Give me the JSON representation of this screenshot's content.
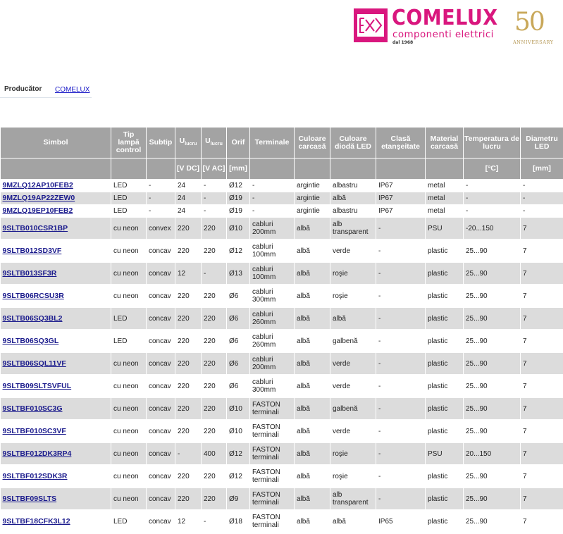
{
  "logo": {
    "brand": "COMELUX",
    "tagline": "componenti elettrici",
    "since": "dal 1968",
    "anniversary_number": "50",
    "anniversary_text": "ANNIVERSARY",
    "brand_color": "#d9177e",
    "gold_color": "#c9a85a"
  },
  "producer": {
    "label": "Producător",
    "value": "COMELUX"
  },
  "table": {
    "headers": {
      "simbol": "Simbol",
      "tip": "Tip lampă control",
      "subtip": "Subtip",
      "ulucru_dc_main": "U",
      "ulucru_dc_sub": "lucru",
      "ulucru_ac_main": "U",
      "ulucru_ac_sub": "lucru",
      "orif": "Orif",
      "terminale": "Terminale",
      "culoare_carcasa": "Culoare carcasă",
      "culoare_dioda": "Culoare diodă LED",
      "clasa": "Clasă etanşeitate",
      "material": "Material carcasă",
      "temperatura": "Temperatura de lucru",
      "diametru": "Diametru LED"
    },
    "units": {
      "dc": "[V DC]",
      "ac": "[V AC]",
      "orif": "[mm]",
      "temperatura": "[°C]",
      "diametru": "[mm]"
    },
    "rows": [
      {
        "simbol": "9MZLQ12AP10FEB2",
        "tip": "LED",
        "subtip": "-",
        "vdc": "24",
        "vac": "-",
        "orif": "Ø12",
        "terminale": "-",
        "carcasa": "argintie",
        "dioda": "albastru",
        "clasa": "IP67",
        "material": "metal",
        "temp": "-",
        "diam": "-"
      },
      {
        "simbol": "9MZLQ19AP22ZEW0",
        "tip": "LED",
        "subtip": "-",
        "vdc": "24",
        "vac": "-",
        "orif": "Ø19",
        "terminale": "-",
        "carcasa": "argintie",
        "dioda": "albă",
        "clasa": "IP67",
        "material": "metal",
        "temp": "-",
        "diam": "-"
      },
      {
        "simbol": "9MZLQ19EP10FEB2",
        "tip": "LED",
        "subtip": "-",
        "vdc": "24",
        "vac": "-",
        "orif": "Ø19",
        "terminale": "-",
        "carcasa": "argintie",
        "dioda": "albastru",
        "clasa": "IP67",
        "material": "metal",
        "temp": "-",
        "diam": "-"
      },
      {
        "simbol": "9SLTB010CSR1BP",
        "tip": "cu neon",
        "subtip": "convex",
        "vdc": "220",
        "vac": "220",
        "orif": "Ø10",
        "terminale": "cabluri 200mm",
        "carcasa": "albă",
        "dioda": "alb transparent",
        "clasa": "-",
        "material": "PSU",
        "temp": "-20...150",
        "diam": "7"
      },
      {
        "simbol": "9SLTB012SD3VF",
        "tip": "cu neon",
        "subtip": "concav",
        "vdc": "220",
        "vac": "220",
        "orif": "Ø12",
        "terminale": "cabluri 100mm",
        "carcasa": "albă",
        "dioda": "verde",
        "clasa": "-",
        "material": "plastic",
        "temp": "25...90",
        "diam": "7"
      },
      {
        "simbol": "9SLTB013SF3R",
        "tip": "cu neon",
        "subtip": "concav",
        "vdc": "12",
        "vac": "-",
        "orif": "Ø13",
        "terminale": "cabluri 100mm",
        "carcasa": "albă",
        "dioda": "roşie",
        "clasa": "-",
        "material": "plastic",
        "temp": "25...90",
        "diam": "7"
      },
      {
        "simbol": "9SLTB06RCSU3R",
        "tip": "cu neon",
        "subtip": "concav",
        "vdc": "220",
        "vac": "220",
        "orif": "Ø6",
        "terminale": "cabluri 300mm",
        "carcasa": "albă",
        "dioda": "roşie",
        "clasa": "-",
        "material": "plastic",
        "temp": "25...90",
        "diam": "7"
      },
      {
        "simbol": "9SLTB06SQ3BL2",
        "tip": "LED",
        "subtip": "concav",
        "vdc": "220",
        "vac": "220",
        "orif": "Ø6",
        "terminale": "cabluri 260mm",
        "carcasa": "albă",
        "dioda": "albă",
        "clasa": "-",
        "material": "plastic",
        "temp": "25...90",
        "diam": "7"
      },
      {
        "simbol": "9SLTB06SQ3GL",
        "tip": "LED",
        "subtip": "concav",
        "vdc": "220",
        "vac": "220",
        "orif": "Ø6",
        "terminale": "cabluri 260mm",
        "carcasa": "albă",
        "dioda": "galbenă",
        "clasa": "-",
        "material": "plastic",
        "temp": "25...90",
        "diam": "7"
      },
      {
        "simbol": "9SLTB06SQL11VF",
        "tip": "cu neon",
        "subtip": "concav",
        "vdc": "220",
        "vac": "220",
        "orif": "Ø6",
        "terminale": "cabluri 200mm",
        "carcasa": "albă",
        "dioda": "verde",
        "clasa": "-",
        "material": "plastic",
        "temp": "25...90",
        "diam": "7"
      },
      {
        "simbol": "9SLTB09SLTSVFUL",
        "tip": "cu neon",
        "subtip": "concav",
        "vdc": "220",
        "vac": "220",
        "orif": "Ø6",
        "terminale": "cabluri 300mm",
        "carcasa": "albă",
        "dioda": "verde",
        "clasa": "-",
        "material": "plastic",
        "temp": "25...90",
        "diam": "7"
      },
      {
        "simbol": "9SLTBF010SC3G",
        "tip": "cu neon",
        "subtip": "concav",
        "vdc": "220",
        "vac": "220",
        "orif": "Ø10",
        "terminale": "FASTON terminali",
        "carcasa": "albă",
        "dioda": "galbenă",
        "clasa": "-",
        "material": "plastic",
        "temp": "25...90",
        "diam": "7"
      },
      {
        "simbol": "9SLTBF010SC3VF",
        "tip": "cu neon",
        "subtip": "concav",
        "vdc": "220",
        "vac": "220",
        "orif": "Ø10",
        "terminale": "FASTON terminali",
        "carcasa": "albă",
        "dioda": "verde",
        "clasa": "-",
        "material": "plastic",
        "temp": "25...90",
        "diam": "7"
      },
      {
        "simbol": "9SLTBF012DK3RP4",
        "tip": "cu neon",
        "subtip": "concav",
        "vdc": "-",
        "vac": "400",
        "orif": "Ø12",
        "terminale": "FASTON terminali",
        "carcasa": "albă",
        "dioda": "roşie",
        "clasa": "-",
        "material": "PSU",
        "temp": "20...150",
        "diam": "7"
      },
      {
        "simbol": "9SLTBF012SDK3R",
        "tip": "cu neon",
        "subtip": "concav",
        "vdc": "220",
        "vac": "220",
        "orif": "Ø12",
        "terminale": "FASTON terminali",
        "carcasa": "albă",
        "dioda": "roşie",
        "clasa": "-",
        "material": "plastic",
        "temp": "25...90",
        "diam": "7"
      },
      {
        "simbol": "9SLTBF09SLTS",
        "tip": "cu neon",
        "subtip": "concav",
        "vdc": "220",
        "vac": "220",
        "orif": "Ø9",
        "terminale": "FASTON terminali",
        "carcasa": "albă",
        "dioda": "alb transparent",
        "clasa": "-",
        "material": "plastic",
        "temp": "25...90",
        "diam": "7"
      },
      {
        "simbol": "9SLTBF18CFK3L12",
        "tip": "LED",
        "subtip": "concav",
        "vdc": "12",
        "vac": "-",
        "orif": "Ø18",
        "terminale": "FASTON terminali",
        "carcasa": "albă",
        "dioda": "albă",
        "clasa": "IP65",
        "material": "plastic",
        "temp": "25...90",
        "diam": "7"
      }
    ]
  }
}
